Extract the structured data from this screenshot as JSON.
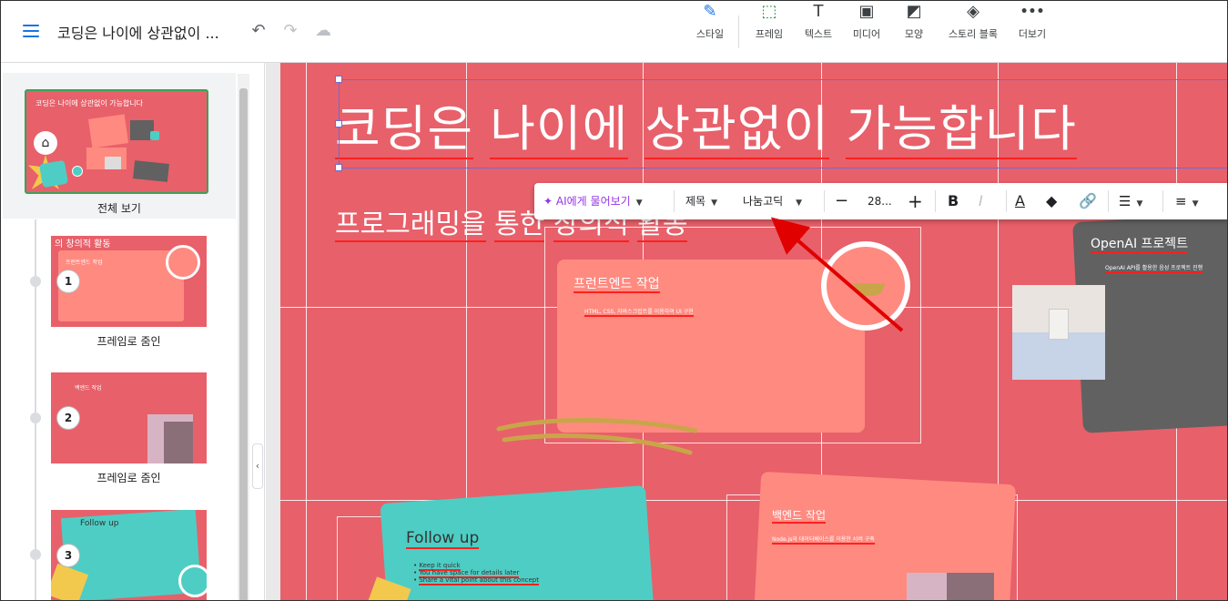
{
  "header": {
    "doc_title": "코딩은 나이에 상관없이 ...",
    "tools": [
      {
        "label": "스타일",
        "icon": "brush-icon",
        "glyph": "🖌"
      },
      {
        "label": "프레임",
        "icon": "frame-add-icon",
        "glyph": "⬚"
      },
      {
        "label": "텍스트",
        "icon": "text-icon",
        "glyph": "T"
      },
      {
        "label": "미디어",
        "icon": "image-icon",
        "glyph": "▣"
      },
      {
        "label": "모양",
        "icon": "shape-icon",
        "glyph": "◩"
      },
      {
        "label": "스토리 블록",
        "icon": "layers-icon",
        "glyph": "◈"
      },
      {
        "label": "더보기",
        "icon": "more-icon",
        "glyph": "•••"
      }
    ]
  },
  "sidebar": {
    "overview_label": "전체 보기",
    "overview_title": "코딩은 나이에 상관없이 가능합니다",
    "frames": [
      {
        "num": "1",
        "label": "프레임로 줌인",
        "thumb_title": "의 창의적 활동",
        "thumb_sub": "프런트엔드 작업"
      },
      {
        "num": "2",
        "label": "프레임로 줌인",
        "thumb_title": "백엔드 작업",
        "thumb_sub": ""
      },
      {
        "num": "3",
        "label": "",
        "thumb_title": "Follow up",
        "thumb_sub": ""
      }
    ]
  },
  "slide": {
    "title": [
      "코딩은",
      "나이에",
      "상관없이",
      "가능합니다"
    ],
    "subtitle": [
      "프로그래밍을",
      "통한",
      "창의적",
      "활동"
    ],
    "front_title": "프런트엔드 작업",
    "front_sub": "HTML, CSS, 자바스크립트를 이용하여 UI 구현",
    "openai_title": "OpenAI 프로젝트",
    "openai_sub": "OpenAI API를 활용한 음성 프로젝트 진행",
    "backend_title": "백엔드 작업",
    "backend_sub": "Node.js와 데이터베이스를 이용한 서버 구축",
    "followup_title": "Follow up",
    "followup_items": [
      "Keep it quick",
      "You have space for details later",
      "Share a vital point about this concept"
    ]
  },
  "text_toolbar": {
    "ai_label": "AI에게 물어보기",
    "style_label": "제목",
    "font_label": "나눔고딕",
    "size_value": "28..."
  },
  "colors": {
    "slide_bg": "#e8606a",
    "card": "#ff8a80",
    "teal": "#4ecdc4",
    "dark": "#616161",
    "accent": "#1a73e8",
    "ai_purple": "#9334e6"
  }
}
